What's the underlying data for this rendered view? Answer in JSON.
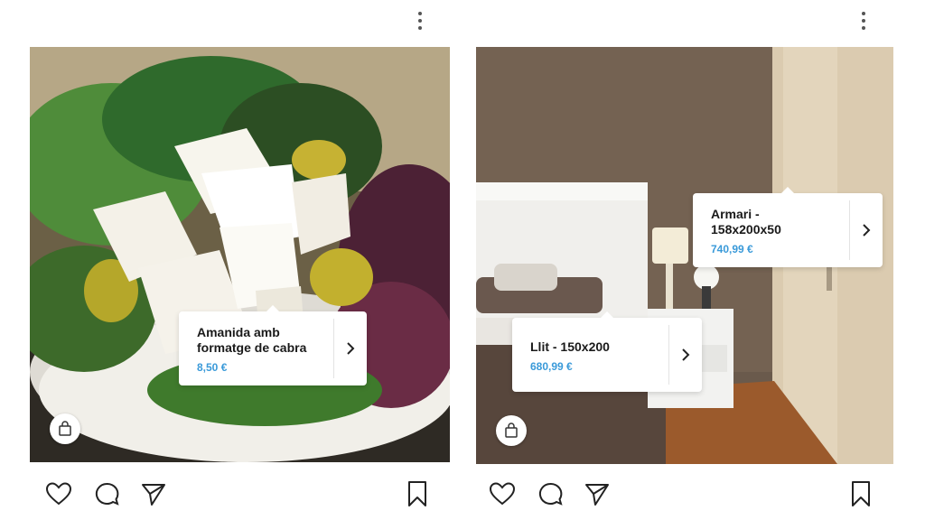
{
  "posts": [
    {
      "tag": {
        "name": "Amanida amb\nformatge de cabra",
        "price": "8,50 €"
      }
    },
    {
      "tags": [
        {
          "name": "Armari -\n158x200x50",
          "price": "740,99 €"
        },
        {
          "name": "Llit - 150x200",
          "price": "680,99 €"
        }
      ]
    }
  ],
  "icons": {
    "more": "more-options-icon",
    "shop": "shopping-bag-icon",
    "arrow": "chevron-right-icon",
    "like": "heart-icon",
    "comment": "comment-icon",
    "share": "send-icon",
    "save": "bookmark-icon"
  },
  "colors": {
    "price": "#3a9ad9"
  }
}
